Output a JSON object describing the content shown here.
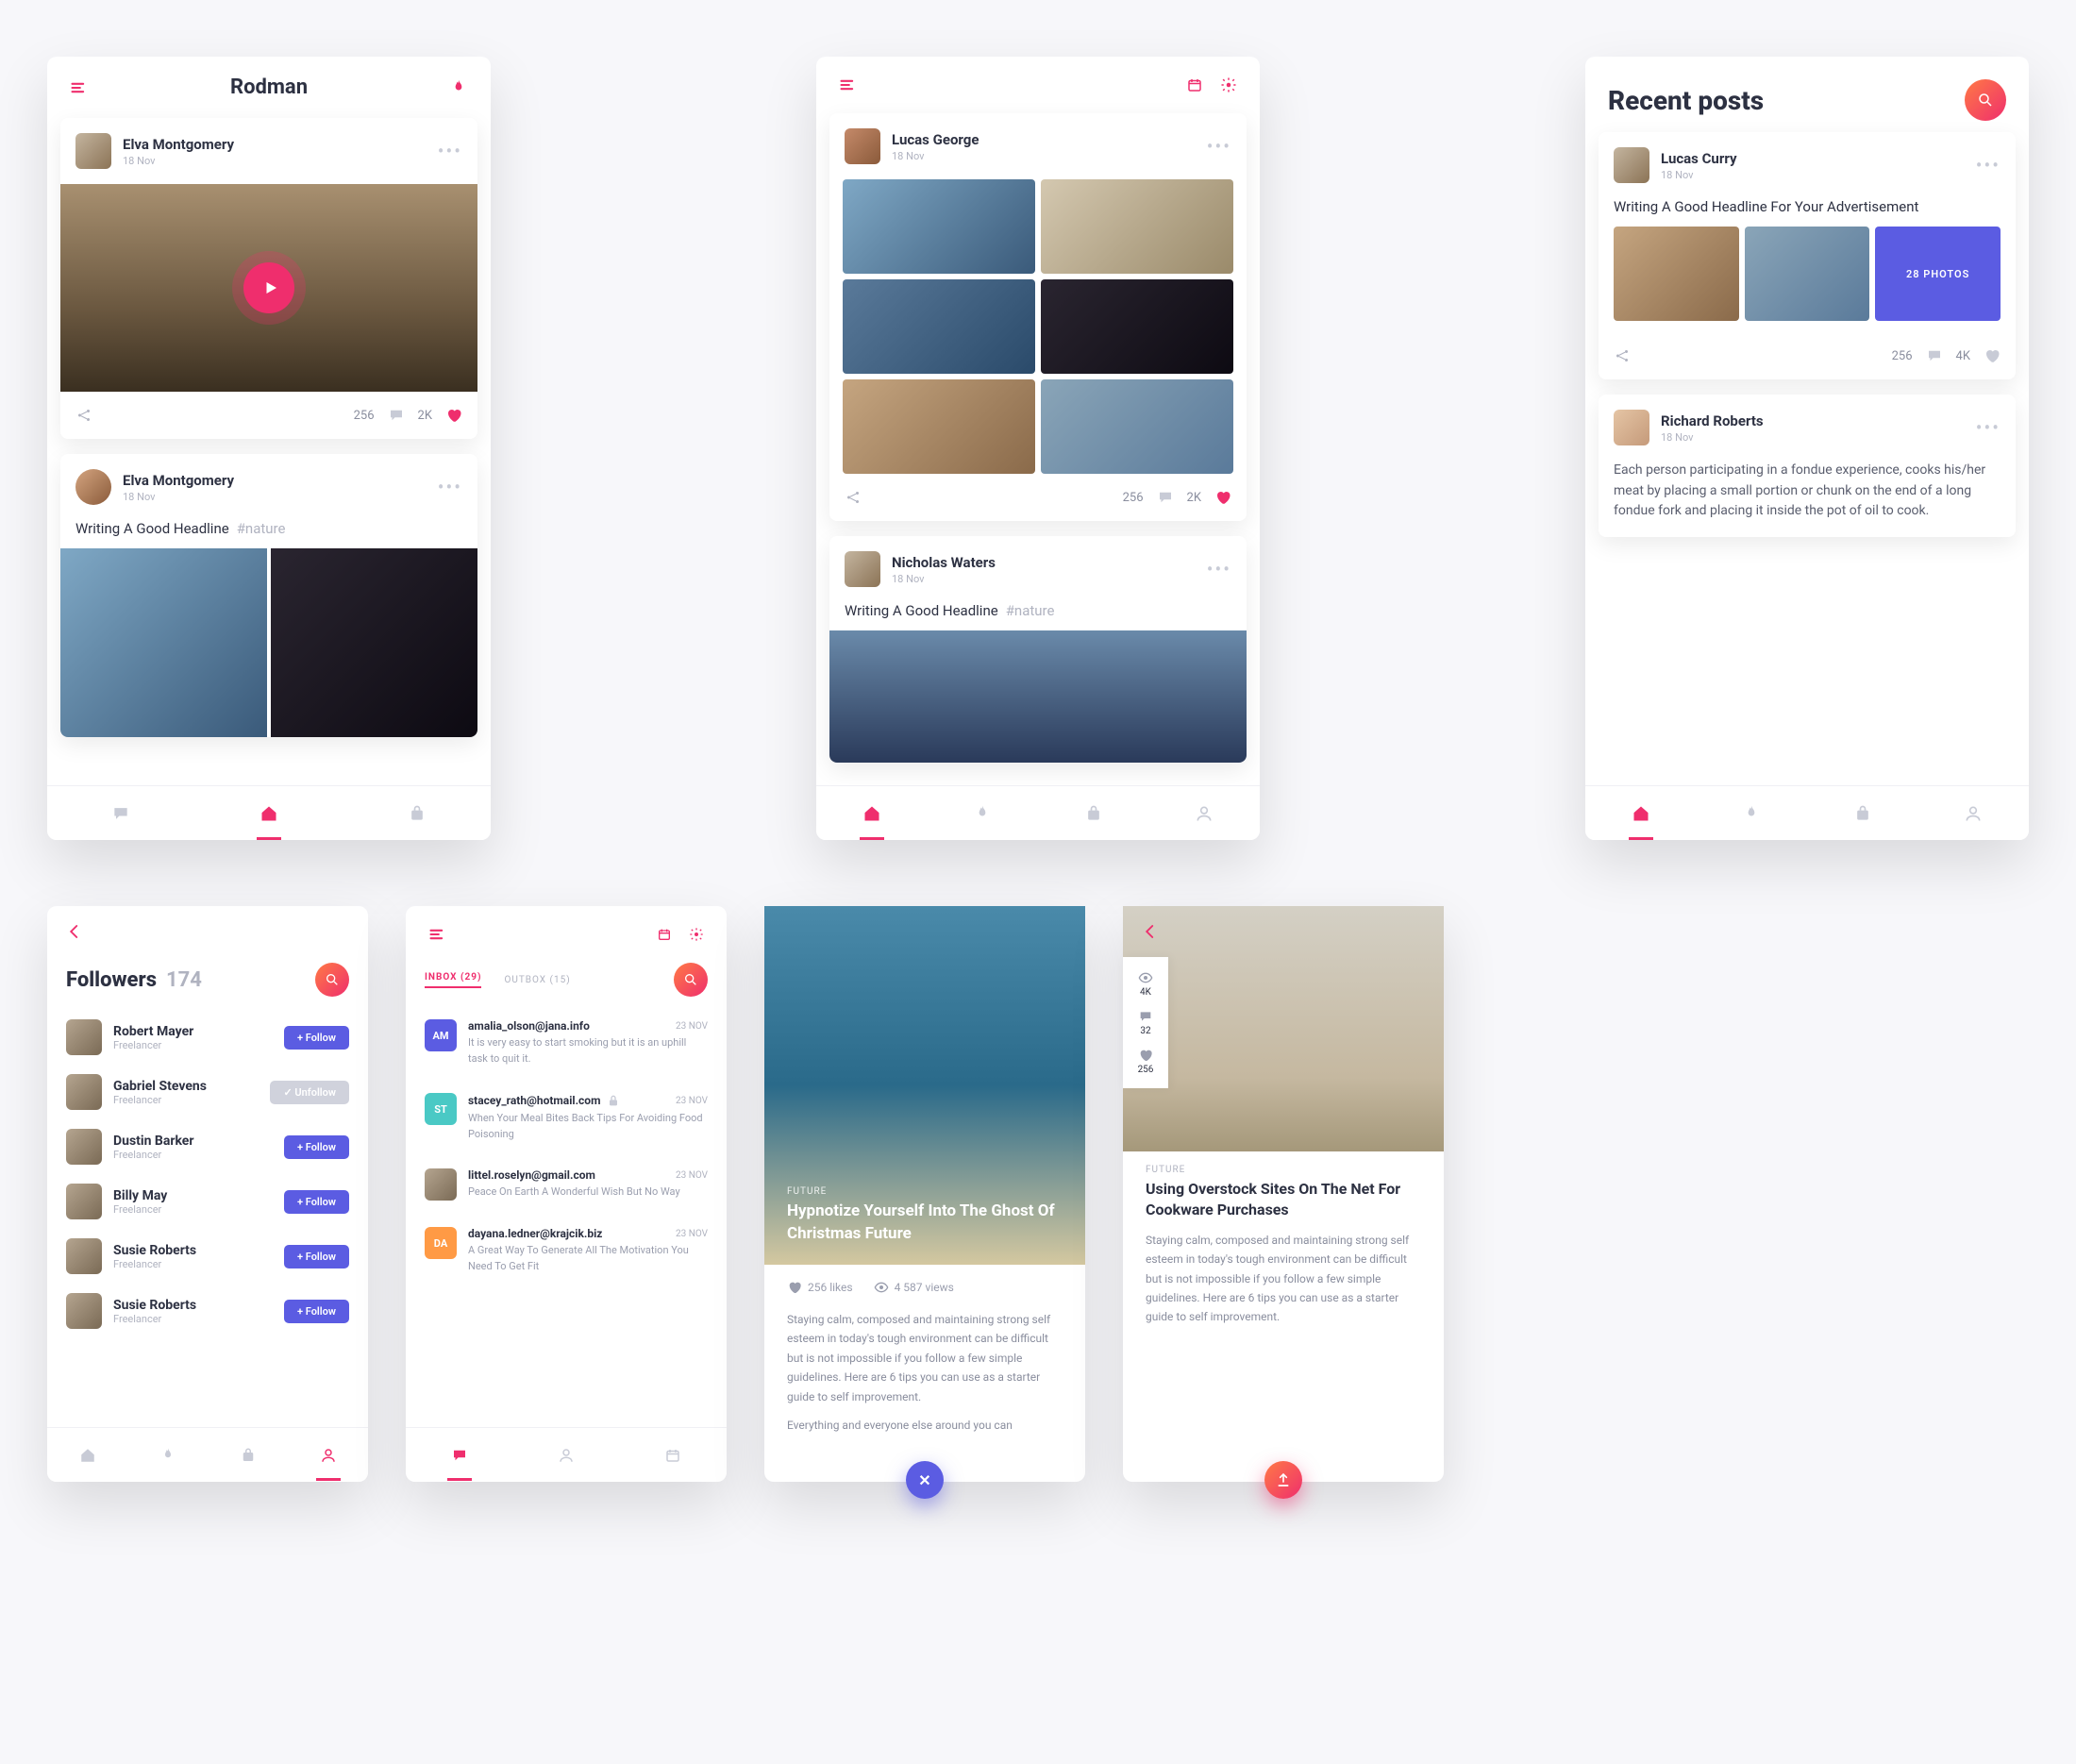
{
  "colors": {
    "accent": "#ef2e6d",
    "accent2": "#5b5ce2",
    "muted": "#b0b3c0"
  },
  "screen1": {
    "title": "Rodman",
    "post1": {
      "author": "Elva Montgomery",
      "date": "18 Nov",
      "comments": "256",
      "likes": "2K"
    },
    "post2": {
      "author": "Elva Montgomery",
      "date": "18 Nov",
      "headline": "Writing A Good Headline",
      "tag": "#nature"
    },
    "nav": [
      "chat",
      "home",
      "bag"
    ]
  },
  "screen2": {
    "post1": {
      "author": "Lucas George",
      "date": "18 Nov",
      "comments": "256",
      "likes": "2K"
    },
    "post2": {
      "author": "Nicholas Waters",
      "date": "18 Nov",
      "headline": "Writing A Good Headline",
      "tag": "#nature"
    },
    "nav": [
      "home",
      "fire",
      "bag",
      "profile"
    ]
  },
  "screen3": {
    "title": "Recent posts",
    "post1": {
      "author": "Lucas Curry",
      "date": "18 Nov",
      "headline": "Writing A Good Headline For Your Advertisement",
      "photos_label": "28 PHOTOS",
      "comments": "256",
      "likes": "4K"
    },
    "post2": {
      "author": "Richard Roberts",
      "date": "18 Nov",
      "body": "Each person participating in a fondue experience, cooks his/her meat by placing a small portion or chunk on the end of a long fondue fork and placing it inside the pot of oil to cook."
    },
    "nav": [
      "home",
      "fire",
      "bag",
      "profile"
    ]
  },
  "followers": {
    "title": "Followers",
    "count": "174",
    "list": [
      {
        "name": "Robert Mayer",
        "sub": "Freelancer",
        "btn": "+ Follow",
        "un": false
      },
      {
        "name": "Gabriel Stevens",
        "sub": "Freelancer",
        "btn": "✓ Unfollow",
        "un": true
      },
      {
        "name": "Dustin Barker",
        "sub": "Freelancer",
        "btn": "+ Follow",
        "un": false
      },
      {
        "name": "Billy May",
        "sub": "Freelancer",
        "btn": "+ Follow",
        "un": false
      },
      {
        "name": "Susie Roberts",
        "sub": "Freelancer",
        "btn": "+ Follow",
        "un": false
      },
      {
        "name": "Susie Roberts",
        "sub": "Freelancer",
        "btn": "+ Follow",
        "un": false
      }
    ],
    "nav": [
      "home",
      "fire",
      "bag",
      "profile"
    ]
  },
  "inbox": {
    "tabs": [
      "INBOX (29)",
      "OUTBOX (15)"
    ],
    "messages": [
      {
        "av": "AM",
        "cls": "blue",
        "from": "amalia_olson@jana.info",
        "date": "23 NOV",
        "snip": "It is very easy to start smoking but it is an uphill task to quit it.",
        "lock": false
      },
      {
        "av": "ST",
        "cls": "teal",
        "from": "stacey_rath@hotmail.com",
        "date": "23 NOV",
        "snip": "When Your Meal Bites Back Tips For Avoiding Food Poisoning",
        "lock": true
      },
      {
        "av": "",
        "cls": "img",
        "from": "littel.roselyn@gmail.com",
        "date": "23 NOV",
        "snip": "Peace On Earth A Wonderful Wish But No Way",
        "lock": false
      },
      {
        "av": "DA",
        "cls": "org",
        "from": "dayana.ledner@krajcik.biz",
        "date": "23 NOV",
        "snip": "A Great Way To Generate All The Motivation You Need To Get Fit",
        "lock": false
      }
    ],
    "nav": [
      "chat",
      "profile",
      "calendar"
    ]
  },
  "article1": {
    "cat": "FUTURE",
    "title": "Hypnotize Yourself Into The Ghost Of Christmas Future",
    "likes": "256 likes",
    "views": "4 587 views",
    "body": "Staying calm, composed and maintaining strong self esteem in today's tough environment can be difficult but is not impossible if you follow a few simple guidelines. Here are 6 tips you can use as a starter guide to self improvement.",
    "body2": "Everything and everyone else around you can"
  },
  "article2": {
    "cat": "FUTURE",
    "title": "Using Overstock Sites On The Net For Cookware Purchases",
    "body": "Staying calm, composed and maintaining strong self esteem in today's tough environment can be difficult but is not impossible if you follow a few simple guidelines. Here are 6 tips you can use as a starter guide to self improvement.",
    "stats": {
      "views": "4K",
      "comments": "32",
      "likes": "256"
    }
  }
}
